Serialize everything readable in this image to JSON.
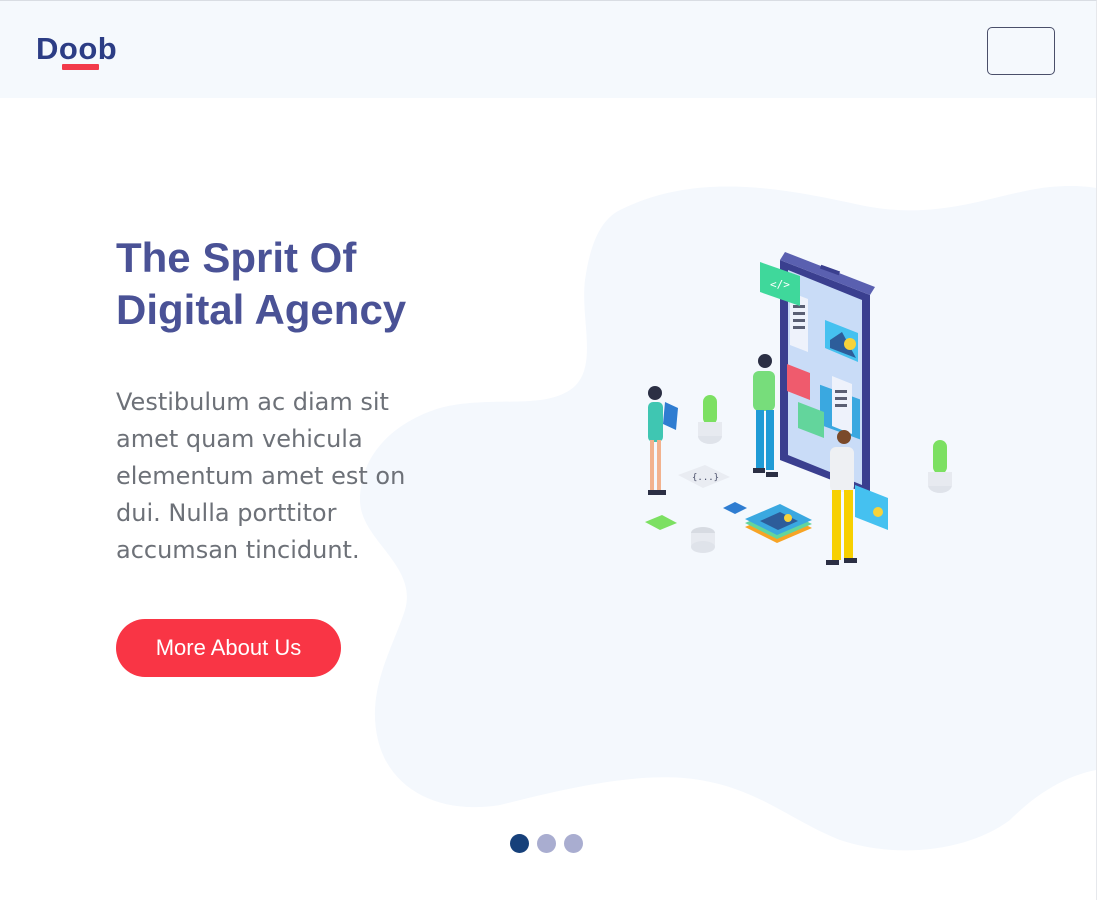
{
  "header": {
    "logo_text": "Doob",
    "menu_button_label": ""
  },
  "hero": {
    "title": "The Sprit Of Digital Agency",
    "description": "Vestibulum ac diam sit amet quam vehicula elementum amet est on dui. Nulla porttitor accumsan tincidunt.",
    "cta_label": "More About Us"
  },
  "illustration": {
    "code_chip_text": "</>",
    "braces_text": "{...}"
  },
  "slider": {
    "dots": [
      "slide-1",
      "slide-2",
      "slide-3"
    ],
    "active_index": 0
  },
  "colors": {
    "brand": "#2c3d85",
    "accent": "#f93545",
    "title": "#4a5296",
    "header_bg": "#f5f9fd",
    "blob": "#f4f8fd"
  }
}
